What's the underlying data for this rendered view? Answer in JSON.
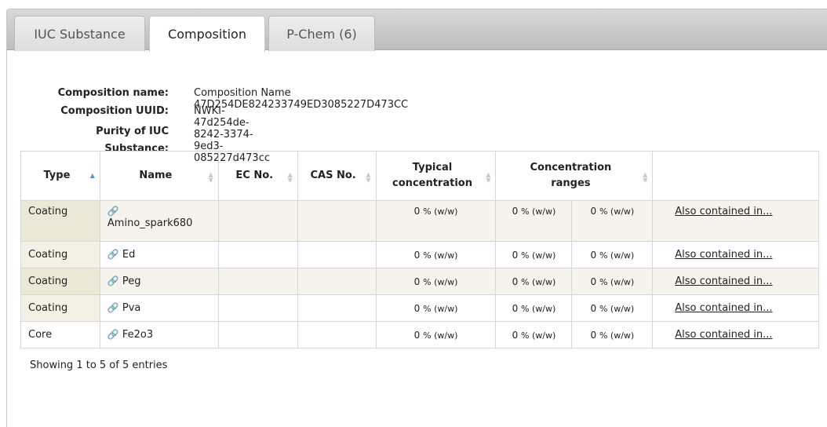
{
  "tabs": [
    {
      "label": "IUC Substance",
      "active": false
    },
    {
      "label": "Composition",
      "active": true
    },
    {
      "label": "P-Chem (6)",
      "active": false
    }
  ],
  "composition": {
    "name_label": "Composition name:",
    "name_value": "Composition Name 47D254DE824233749ED3085227D473CC",
    "uuid_label": "Composition UUID:",
    "uuid_value": "NWKI-47d254de-8242-3374-9ed3-085227d473cc",
    "purity_label_1": "Purity of IUC",
    "purity_label_2": "Substance:"
  },
  "table": {
    "headers": {
      "type": "Type",
      "name": "Name",
      "ec": "EC No.",
      "cas": "CAS No.",
      "typical_1": "Typical",
      "typical_2": "concentration",
      "ranges_1": "Concentration",
      "ranges_2": "ranges"
    },
    "rows": [
      {
        "type": "Coating",
        "name": "Amino_spark680",
        "ec": "",
        "cas": "",
        "typical": "0",
        "min": "0",
        "max": "0",
        "unit": "% (w/w)",
        "link": "Also contained in..."
      },
      {
        "type": "Coating",
        "name": "Ed",
        "ec": "",
        "cas": "",
        "typical": "0",
        "min": "0",
        "max": "0",
        "unit": "% (w/w)",
        "link": "Also contained in..."
      },
      {
        "type": "Coating",
        "name": "Peg",
        "ec": "",
        "cas": "",
        "typical": "0",
        "min": "0",
        "max": "0",
        "unit": "% (w/w)",
        "link": "Also contained in..."
      },
      {
        "type": "Coating",
        "name": "Pva",
        "ec": "",
        "cas": "",
        "typical": "0",
        "min": "0",
        "max": "0",
        "unit": "% (w/w)",
        "link": "Also contained in..."
      },
      {
        "type": "Core",
        "name": "Fe2o3",
        "ec": "",
        "cas": "",
        "typical": "0",
        "min": "0",
        "max": "0",
        "unit": "% (w/w)",
        "link": "Also contained in..."
      }
    ]
  },
  "footer": {
    "showing": "Showing 1 to 5 of 5 entries"
  },
  "icons": {
    "link": "link-icon",
    "sort": "sort-icon",
    "sort_asc": "sort-asc-icon"
  }
}
